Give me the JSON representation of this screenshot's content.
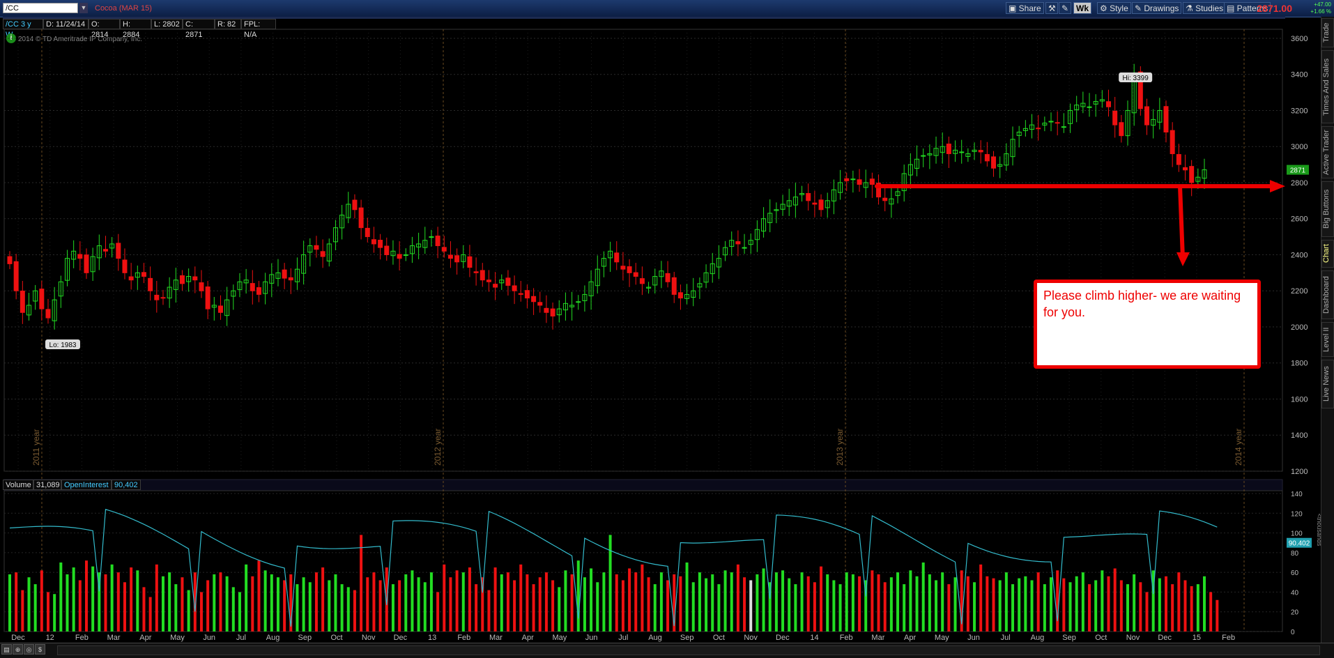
{
  "toolbar": {
    "symbol": "/CC",
    "description": "Cocoa (MAR 15)",
    "share": "Share",
    "timeframe": "Wk",
    "style": "Style",
    "drawings": "Drawings",
    "studies": "Studies",
    "patterns": "Patterns",
    "last_price": "2871.00",
    "change_pts": "+47.00",
    "change_pct": "+1.66 %"
  },
  "infobar": {
    "symbol_tag": "/CC 3 y W",
    "date": "D: 11/24/14",
    "open": "O: 2814",
    "high": "H: 2884",
    "low": "L: 2802",
    "close": "C: 2871",
    "range": "R: 82",
    "fpl": "FPL: N/A",
    "copyright": "2014 © TD Ameritrade IP Company, Inc."
  },
  "annotation": {
    "text": "Please climb higher- we are waiting for you."
  },
  "volume_bar": {
    "volume_label": "Volume",
    "volume_value": "31,089",
    "oi_label": "OpenInterest",
    "oi_value": "90,402",
    "unit_label": "<thousands"
  },
  "side_tabs": [
    "Trade",
    "Times And Sales",
    "Active Trader",
    "Big Buttons",
    "Chart",
    "Dashboard",
    "Level II",
    "Live News"
  ],
  "colors": {
    "up": "#22dd22",
    "down": "#ee1111",
    "oi_line": "#33bbcc",
    "annotation": "#ee0000"
  },
  "chart_data": {
    "type": "candlestick",
    "title": "Cocoa (MAR 15)",
    "price_axis": {
      "ylim": [
        1200,
        3650
      ],
      "ticks": [
        1200,
        1400,
        1600,
        1800,
        2000,
        2200,
        2400,
        2600,
        2800,
        3000,
        3200,
        3400,
        3600
      ]
    },
    "last_price_badge": "2871",
    "hi_label": "Hi: 3399",
    "lo_label": "Lo: 1983",
    "year_markers": [
      "2011 year",
      "2012 year",
      "2013 year",
      "2014 year"
    ],
    "resistance_line": 2780,
    "volume_axis": {
      "ylim": [
        0,
        140
      ],
      "ticks": [
        0,
        20,
        40,
        60,
        80,
        100,
        120,
        140
      ],
      "oi_badge": "90.402"
    },
    "x_labels": [
      "Dec",
      "12",
      "Feb",
      "Mar",
      "Apr",
      "May",
      "Jun",
      "Jul",
      "Aug",
      "Sep",
      "Oct",
      "Nov",
      "Dec",
      "13",
      "Feb",
      "Mar",
      "Apr",
      "May",
      "Jun",
      "Jul",
      "Aug",
      "Sep",
      "Oct",
      "Nov",
      "Dec",
      "14",
      "Feb",
      "Mar",
      "Apr",
      "May",
      "Jun",
      "Jul",
      "Aug",
      "Sep",
      "Oct",
      "Nov",
      "Dec",
      "15",
      "Feb"
    ],
    "closes": [
      2350,
      2200,
      2080,
      2120,
      2200,
      2100,
      2050,
      2150,
      2250,
      2380,
      2420,
      2380,
      2300,
      2390,
      2450,
      2420,
      2460,
      2380,
      2300,
      2260,
      2300,
      2280,
      2200,
      2150,
      2160,
      2220,
      2260,
      2240,
      2280,
      2260,
      2200,
      2100,
      2120,
      2080,
      2150,
      2200,
      2250,
      2260,
      2200,
      2180,
      2250,
      2290,
      2300,
      2270,
      2260,
      2320,
      2400,
      2450,
      2430,
      2390,
      2460,
      2550,
      2620,
      2680,
      2650,
      2550,
      2500,
      2460,
      2440,
      2400,
      2420,
      2380,
      2400,
      2450,
      2460,
      2480,
      2500,
      2450,
      2420,
      2380,
      2360,
      2400,
      2330,
      2300,
      2260,
      2250,
      2220,
      2260,
      2230,
      2200,
      2180,
      2160,
      2140,
      2120,
      2080,
      2060,
      2100,
      2130,
      2120,
      2140,
      2180,
      2250,
      2320,
      2380,
      2420,
      2360,
      2320,
      2300,
      2280,
      2240,
      2220,
      2280,
      2310,
      2250,
      2180,
      2160,
      2180,
      2200,
      2240,
      2300,
      2350,
      2380,
      2440,
      2480,
      2460,
      2440,
      2480,
      2540,
      2600,
      2630,
      2650,
      2680,
      2700,
      2720,
      2740,
      2700,
      2680,
      2650,
      2700,
      2760,
      2800,
      2810,
      2820,
      2790,
      2800,
      2790,
      2720,
      2700,
      2710,
      2750,
      2850,
      2900,
      2930,
      2950,
      2960,
      2990,
      3000,
      2960,
      2980,
      2970,
      2960,
      2980,
      2970,
      2920,
      2880,
      2900,
      2960,
      3040,
      3080,
      3100,
      3120,
      3100,
      3130,
      3140,
      3130,
      3110,
      3200,
      3230,
      3240,
      3220,
      3250,
      3260,
      3220,
      3120,
      3060,
      3200,
      3390,
      3210,
      3120,
      3150,
      3200,
      3080,
      2960,
      2900,
      2870,
      2800,
      2830,
      2871
    ],
    "volume": [
      58,
      60,
      42,
      55,
      48,
      62,
      40,
      38,
      70,
      58,
      65,
      52,
      72,
      66,
      60,
      58,
      68,
      60,
      50,
      65,
      62,
      45,
      35,
      68,
      56,
      60,
      48,
      55,
      42,
      60,
      40,
      52,
      58,
      60,
      56,
      45,
      40,
      68,
      56,
      72,
      62,
      58,
      55,
      52,
      58,
      48,
      55,
      50,
      60,
      65,
      52,
      58,
      48,
      45,
      42,
      98,
      55,
      60,
      52,
      65,
      48,
      52,
      58,
      62,
      55,
      50,
      60,
      40,
      68,
      55,
      62,
      60,
      65,
      48,
      55,
      42,
      65,
      58,
      60,
      52,
      68,
      58,
      48,
      55,
      60,
      52,
      45,
      62,
      58,
      72,
      55,
      64,
      50,
      60,
      98,
      58,
      52,
      64,
      60,
      68,
      55,
      48,
      60,
      52,
      58,
      56,
      70,
      50,
      60,
      54,
      58,
      48,
      62,
      60,
      68,
      55,
      52,
      58,
      64,
      50,
      60,
      62,
      54,
      48,
      60,
      56,
      50,
      66,
      58,
      52,
      48,
      60,
      58,
      56,
      52,
      62,
      58,
      50,
      55,
      60,
      48,
      62,
      56,
      70,
      58,
      52,
      60,
      48,
      55,
      62,
      56,
      50,
      68,
      56,
      54,
      52,
      60,
      48,
      54,
      56,
      52,
      60,
      48,
      55,
      62,
      54,
      50,
      56,
      60,
      48,
      52,
      62,
      56,
      64,
      52,
      48,
      58,
      50,
      40,
      62,
      54,
      56,
      48,
      60,
      52,
      46,
      48,
      56,
      40,
      32
    ]
  }
}
